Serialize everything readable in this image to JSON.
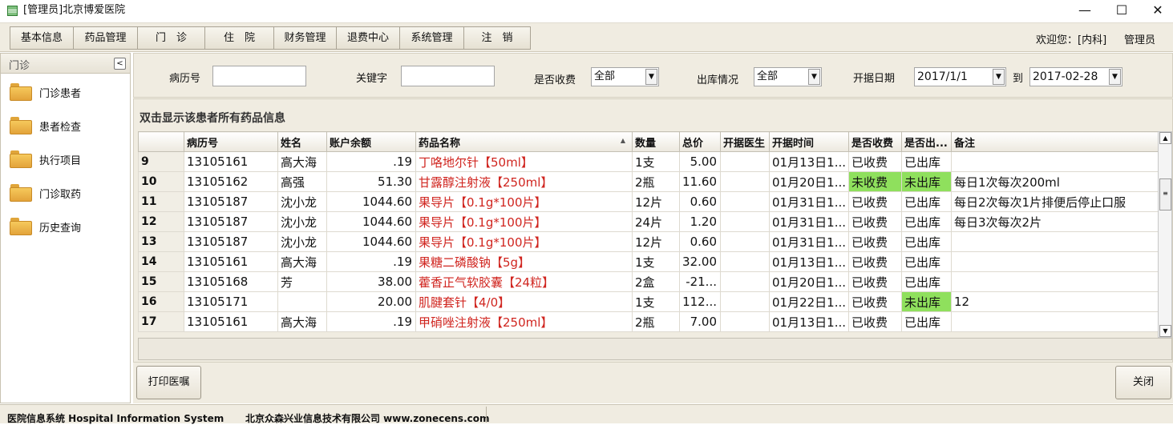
{
  "window": {
    "title": "[管理员]北京博爱医院",
    "minimize": "—",
    "maximize": "☐",
    "close": "✕"
  },
  "menubar": {
    "items": [
      "基本信息",
      "药品管理",
      "门　诊",
      "住　院",
      "财务管理",
      "退费中心",
      "系统管理",
      "注　销"
    ],
    "welcome": "欢迎您：[内科]",
    "role": "管理员"
  },
  "sidebar": {
    "title": "门诊",
    "collapse_glyph": "<",
    "items": [
      "门诊患者",
      "患者检查",
      "执行项目",
      "门诊取药",
      "历史查询"
    ]
  },
  "filters": {
    "record_no_label": "病历号",
    "record_no_value": "",
    "keyword_label": "关键字",
    "keyword_value": "",
    "charged_label": "是否收费",
    "charged_value": "全部",
    "dispensed_label": "出库情况",
    "dispensed_value": "全部",
    "date_label": "开据日期",
    "date_from": "2017/1/1",
    "date_to_label": "到",
    "date_to": "2017-02-28"
  },
  "grid": {
    "caption": "双击显示该患者所有药品信息",
    "columns": [
      "",
      "病历号",
      "姓名",
      "账户余额",
      "药品名称",
      "数量",
      "总价",
      "开据医生",
      "开据时间",
      "是否收费",
      "是否出...",
      "备注"
    ],
    "rows": [
      {
        "no": "9",
        "record": "13105161",
        "name": "高大海",
        "balance": ".19",
        "drug": "丁咯地尔针【50ml】",
        "qty": "1支",
        "total": "5.00",
        "doctor": "",
        "time": "01月13日1...",
        "charged": "已收费",
        "dispensed": "已出库",
        "note": ""
      },
      {
        "no": "10",
        "record": "13105162",
        "name": "高强",
        "balance": "51.30",
        "drug": "甘露醇注射液【250ml】",
        "qty": "2瓶",
        "total": "11.60",
        "doctor": "",
        "time": "01月20日1...",
        "charged": "未收费",
        "dispensed": "未出库",
        "note": "每日1次每次200ml"
      },
      {
        "no": "11",
        "record": "13105187",
        "name": "沈小龙",
        "balance": "1044.60",
        "drug": "果导片【0.1g*100片】",
        "qty": "12片",
        "total": "0.60",
        "doctor": "",
        "time": "01月31日1...",
        "charged": "已收费",
        "dispensed": "已出库",
        "note": "每日2次每次1片排便后停止口服"
      },
      {
        "no": "12",
        "record": "13105187",
        "name": "沈小龙",
        "balance": "1044.60",
        "drug": "果导片【0.1g*100片】",
        "qty": "24片",
        "total": "1.20",
        "doctor": "",
        "time": "01月31日1...",
        "charged": "已收费",
        "dispensed": "已出库",
        "note": "每日3次每次2片"
      },
      {
        "no": "13",
        "record": "13105187",
        "name": "沈小龙",
        "balance": "1044.60",
        "drug": "果导片【0.1g*100片】",
        "qty": "12片",
        "total": "0.60",
        "doctor": "",
        "time": "01月31日1...",
        "charged": "已收费",
        "dispensed": "已出库",
        "note": ""
      },
      {
        "no": "14",
        "record": "13105161",
        "name": "高大海",
        "balance": ".19",
        "drug": "果糖二磷酸钠【5g】",
        "qty": "1支",
        "total": "32.00",
        "doctor": "",
        "time": "01月13日1...",
        "charged": "已收费",
        "dispensed": "已出库",
        "note": ""
      },
      {
        "no": "15",
        "record": "13105168",
        "name": "芳",
        "balance": "38.00",
        "drug": "藿香正气软胶囊【24粒】",
        "qty": "2盒",
        "total": "-21...",
        "doctor": "",
        "time": "01月20日1...",
        "charged": "已收费",
        "dispensed": "已出库",
        "note": ""
      },
      {
        "no": "16",
        "record": "13105171",
        "name": "",
        "balance": "20.00",
        "drug": "肌腱套针【4/0】",
        "qty": "1支",
        "total": "112...",
        "doctor": "",
        "time": "01月22日1...",
        "charged": "已收费",
        "dispensed": "未出库",
        "note": "12"
      },
      {
        "no": "17",
        "record": "13105161",
        "name": "高大海",
        "balance": ".19",
        "drug": "甲硝唑注射液【250ml】",
        "qty": "2瓶",
        "total": "7.00",
        "doctor": "",
        "time": "01月13日1...",
        "charged": "已收费",
        "dispensed": "已出库",
        "note": ""
      }
    ],
    "highlight_color": "#8fe05d",
    "drug_color": "#d0251f"
  },
  "actions": {
    "print": "打印医嘱",
    "close": "关闭"
  },
  "status": {
    "system": "医院信息系统 Hospital Information System",
    "company": "北京众森兴业信息技术有限公司  www.zonecens.com"
  }
}
